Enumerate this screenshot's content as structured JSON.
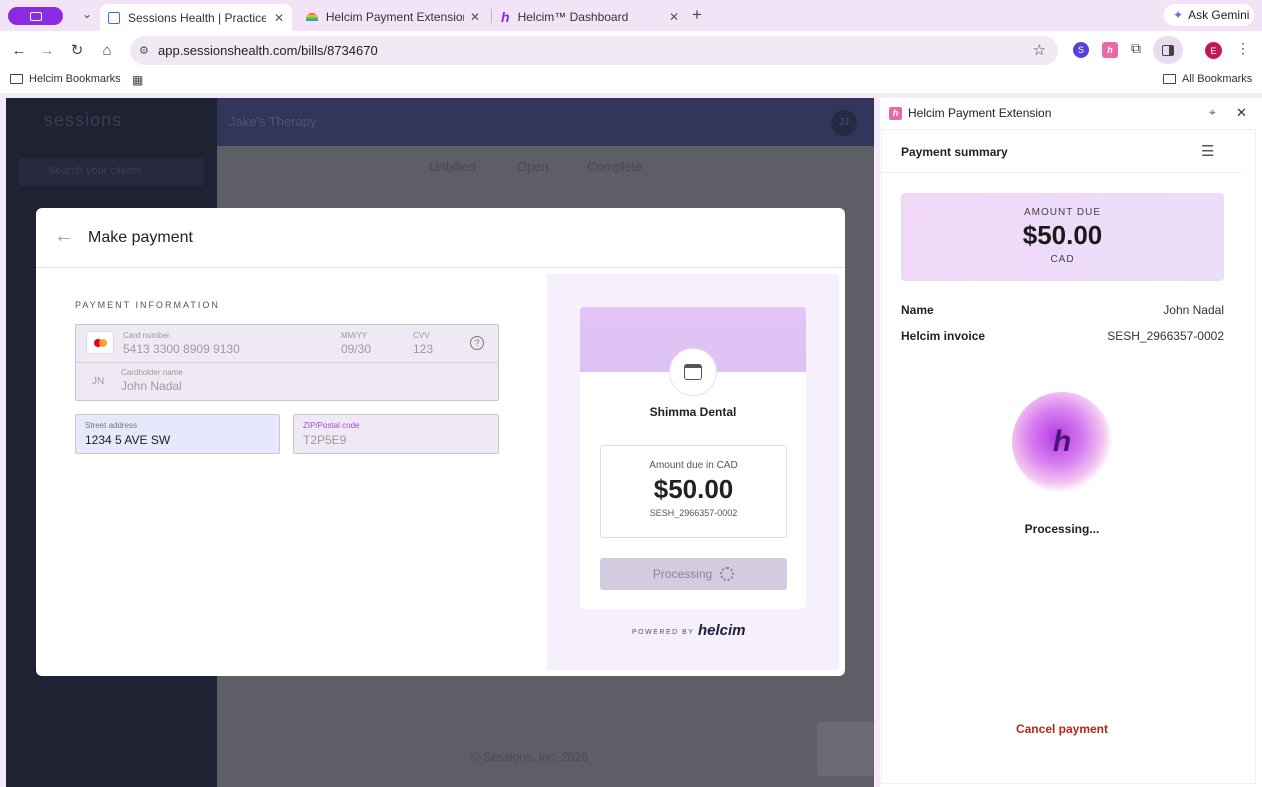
{
  "browser": {
    "tabs": [
      {
        "title": "Sessions Health | Practice Ma"
      },
      {
        "title": "Helcim Payment Extension - C"
      },
      {
        "title": "Helcim™ Dashboard"
      }
    ],
    "new_tab": "+",
    "ask_gemini": "Ask Gemini",
    "url": "app.sessionshealth.com/bills/8734670",
    "profile_initial": "E",
    "ext_s": "S",
    "ext_h": "h",
    "bookmarks": {
      "folder": "Helcim Bookmarks",
      "all": "All Bookmarks"
    }
  },
  "sessions": {
    "logo": "sessions",
    "search_placeholder": "Search your clients",
    "header_title": "Jake's Therapy",
    "user_initials": "JJ",
    "tabs": [
      "Unbilled",
      "Open",
      "Complete"
    ],
    "footer": "© Sessions, Inc. 2026"
  },
  "modal": {
    "title": "Make payment",
    "section_label": "PAYMENT INFORMATION",
    "card_number_label": "Card number",
    "card_number": "5413 3300 8909 9130",
    "expiry_label": "MM/YY",
    "expiry": "09/30",
    "cvv_label": "CVV",
    "cvv": "123",
    "holder_initials": "JN",
    "holder_label": "Cardholder name",
    "holder": "John Nadal",
    "street_label": "Street address",
    "street": "1234 5 AVE SW",
    "zip_label": "ZIP/Postal code",
    "zip": "T2P5E9",
    "merchant": "Shimma Dental",
    "amount_label": "Amount due in CAD",
    "amount": "$50.00",
    "invoice": "SESH_2966357-0002",
    "button": "Processing",
    "powered_by": "POWERED BY",
    "brand": "helcim"
  },
  "panel": {
    "title": "Helcim Payment Extension",
    "section": "Payment summary",
    "amount_due_label": "AMOUNT DUE",
    "amount": "$50.00",
    "currency": "CAD",
    "name_label": "Name",
    "name": "John Nadal",
    "invoice_label": "Helcim invoice",
    "invoice": "SESH_2966357-0002",
    "logo_letter": "h",
    "status": "Processing...",
    "cancel": "Cancel payment"
  },
  "colors": {
    "accent": "#8a2be2",
    "cancel": "#b3261e",
    "navy": "#30375a"
  }
}
